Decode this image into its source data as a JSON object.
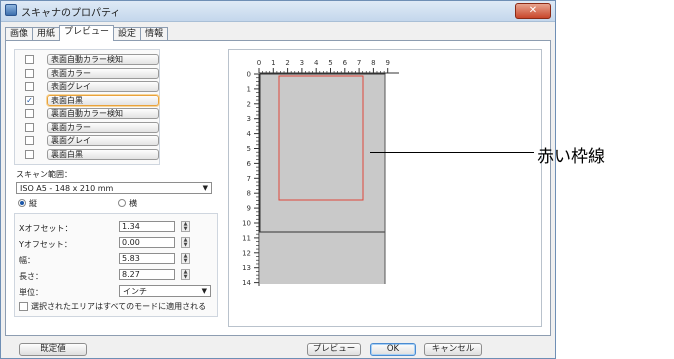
{
  "window": {
    "title": "スキャナのプロパティ",
    "close_label": "✕"
  },
  "tabs": [
    {
      "label": "画像",
      "active": false
    },
    {
      "label": "用紙",
      "active": false
    },
    {
      "label": "プレビュー",
      "active": true
    },
    {
      "label": "設定",
      "active": false
    },
    {
      "label": "情報",
      "active": false
    }
  ],
  "image_types": [
    {
      "label": "表面自動カラー検知",
      "checked": false,
      "selected": false
    },
    {
      "label": "表面カラー",
      "checked": false,
      "selected": false
    },
    {
      "label": "表面グレイ",
      "checked": false,
      "selected": false
    },
    {
      "label": "表面白黒",
      "checked": true,
      "selected": true
    },
    {
      "label": "裏面自動カラー検知",
      "checked": false,
      "selected": false
    },
    {
      "label": "裏面カラー",
      "checked": false,
      "selected": false
    },
    {
      "label": "裏面グレイ",
      "checked": false,
      "selected": false
    },
    {
      "label": "裏面白黒",
      "checked": false,
      "selected": false
    }
  ],
  "scan_area": {
    "label": "スキャン範囲：",
    "value": "ISO A5 - 148 x 210 mm",
    "portrait_label": "縦",
    "landscape_label": "横",
    "orientation": "portrait"
  },
  "offsets": {
    "x_label": "Xオフセット：",
    "x_value": "1.34",
    "y_label": "Yオフセット：",
    "y_value": "0.00",
    "width_label": "幅：",
    "width_value": "5.83",
    "length_label": "長さ：",
    "length_value": "8.27",
    "unit_label": "単位：",
    "unit_value": "インチ"
  },
  "apply_all_label": "選択されたエリアはすべてのモードに適用される",
  "ruler": {
    "top": [
      "0",
      "1",
      "2",
      "3",
      "4",
      "5",
      "6",
      "7",
      "8",
      "9"
    ],
    "left": [
      "0",
      "1",
      "2",
      "3",
      "4",
      "5",
      "6",
      "7",
      "8",
      "9",
      "10",
      "11",
      "12",
      "13",
      "14"
    ]
  },
  "buttons": {
    "default_label": "既定値",
    "preview_label": "プレビュー",
    "ok_label": "OK",
    "cancel_label": "キャンセル"
  },
  "annotation": {
    "label": "赤い枠線"
  },
  "colors": {
    "selection_frame": "#e0463a",
    "scan_area_fill": "#c9c9c9",
    "accent": "#e9a23b"
  }
}
